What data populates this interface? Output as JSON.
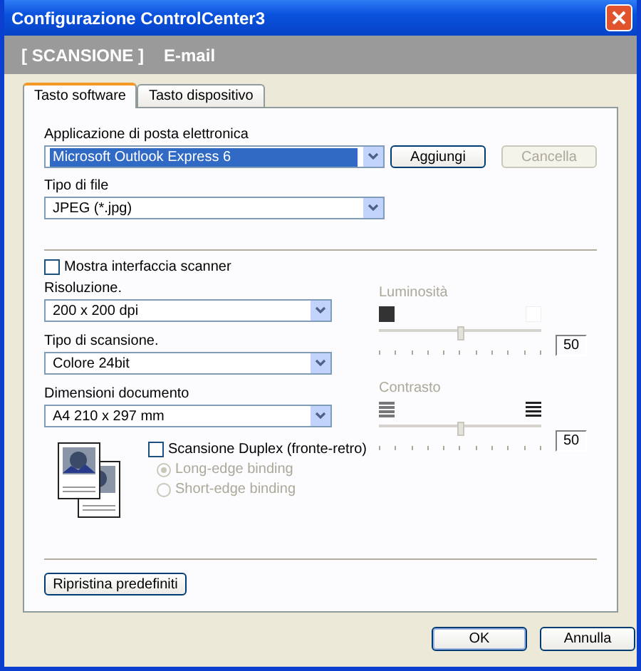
{
  "window": {
    "title": "Configurazione ControlCenter3"
  },
  "header": {
    "section": "[ SCANSIONE ]",
    "page": "E-mail"
  },
  "tabs": [
    {
      "label": "Tasto software",
      "selected": true
    },
    {
      "label": "Tasto dispositivo",
      "selected": false
    }
  ],
  "email_app": {
    "label": "Applicazione di posta elettronica",
    "value": "Microsoft Outlook Express 6",
    "highlighted": true,
    "buttons": [
      {
        "label": "Aggiungi",
        "disabled": false
      },
      {
        "label": "Cancella",
        "disabled": true
      }
    ]
  },
  "file_type": {
    "label": "Tipo di file",
    "value": "JPEG (*.jpg)"
  },
  "show_scanner_interface": {
    "label": "Mostra interfaccia scanner",
    "checked": false
  },
  "settings": [
    {
      "label": "Risoluzione.",
      "value": "200 x 200 dpi"
    },
    {
      "label": "Tipo di scansione.",
      "value": "Colore 24bit"
    },
    {
      "label": "Dimensioni documento",
      "value": "A4 210 x 297 mm"
    }
  ],
  "sliders": [
    {
      "kind": "brightness",
      "label": "Luminosità",
      "disabled": true,
      "level": 0.5,
      "reading": "50"
    },
    {
      "kind": "contrast",
      "label": "Contrasto",
      "disabled": true,
      "level": 0.5,
      "reading": "50"
    }
  ],
  "duplex": {
    "label": "Scansione Duplex (fronte-retro)",
    "checked": false,
    "options": [
      {
        "label": "Long-edge binding",
        "selected": true,
        "disabled": true
      },
      {
        "label": "Short-edge binding",
        "selected": false,
        "disabled": true
      }
    ]
  },
  "reset_button": "Ripristina predefiniti",
  "buttons": [
    {
      "label": "OK",
      "default": true
    },
    {
      "label": "Annulla",
      "default": false
    }
  ]
}
